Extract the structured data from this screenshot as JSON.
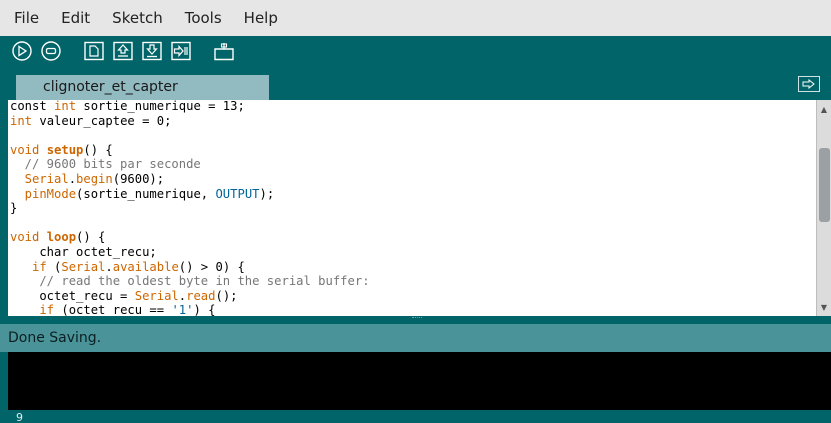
{
  "menu": [
    "File",
    "Edit",
    "Sketch",
    "Tools",
    "Help"
  ],
  "toolbar": {
    "icons": [
      "verify-icon",
      "stop-icon",
      "new-icon",
      "open-icon",
      "save-icon",
      "upload-icon",
      "serial-monitor-icon"
    ]
  },
  "tab": {
    "label": "clignoter_et_capter"
  },
  "code_lines": [
    [
      [
        "tx",
        "const "
      ],
      [
        "kw",
        "int"
      ],
      [
        "tx",
        " sortie_numerique = 13;"
      ]
    ],
    [
      [
        "kw",
        "int"
      ],
      [
        "tx",
        " valeur_captee = 0;"
      ]
    ],
    [
      [
        "tx",
        ""
      ]
    ],
    [
      [
        "kw",
        "void "
      ],
      [
        "kwb",
        "setup"
      ],
      [
        "tx",
        "() {"
      ]
    ],
    [
      [
        "cm",
        "  // 9600 bits par seconde"
      ]
    ],
    [
      [
        "kw",
        "  Serial"
      ],
      [
        "tx",
        "."
      ],
      [
        "kw",
        "begin"
      ],
      [
        "tx",
        "(9600);"
      ]
    ],
    [
      [
        "kw",
        "  pinMode"
      ],
      [
        "tx",
        "(sortie_numerique, "
      ],
      [
        "cn",
        "OUTPUT"
      ],
      [
        "tx",
        ");"
      ]
    ],
    [
      [
        "tx",
        "}"
      ]
    ],
    [
      [
        "tx",
        ""
      ]
    ],
    [
      [
        "kw",
        "void "
      ],
      [
        "kwb",
        "loop"
      ],
      [
        "tx",
        "() {"
      ]
    ],
    [
      [
        "tx",
        "    char octet_recu;"
      ]
    ],
    [
      [
        "kw",
        "   if "
      ],
      [
        "tx",
        "("
      ],
      [
        "kw",
        "Serial"
      ],
      [
        "tx",
        "."
      ],
      [
        "kw",
        "available"
      ],
      [
        "tx",
        "() > 0) {"
      ]
    ],
    [
      [
        "cm",
        "    // read the oldest byte in the serial buffer:"
      ]
    ],
    [
      [
        "tx",
        "    octet_recu = "
      ],
      [
        "kw",
        "Serial"
      ],
      [
        "tx",
        "."
      ],
      [
        "kw",
        "read"
      ],
      [
        "tx",
        "();"
      ]
    ],
    [
      [
        "kw",
        "    if "
      ],
      [
        "tx",
        "(octet_recu == "
      ],
      [
        "st",
        "'1'"
      ],
      [
        "tx",
        ") {"
      ]
    ]
  ],
  "status": {
    "message": "Done Saving."
  },
  "line_number": "9",
  "colors": {
    "chrome": "#006468",
    "keyword": "#cc6600",
    "comment": "#777777",
    "constant": "#006699"
  }
}
